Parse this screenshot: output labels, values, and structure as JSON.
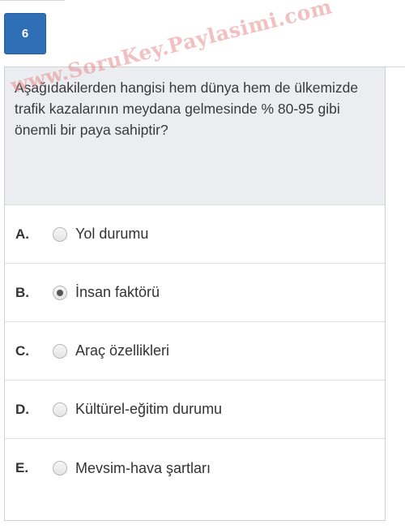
{
  "question_number": "6",
  "watermark": "www.SoruKey.Paylasimi.com",
  "question_text": "Aşağıdakilerden hangisi hem dünya hem de ülkemizde trafik kazalarının meydana gelmesinde % 80-95 gibi önemli bir paya sahiptir?",
  "options": [
    {
      "letter": "A.",
      "text": "Yol durumu",
      "selected": false
    },
    {
      "letter": "B.",
      "text": "İnsan faktörü",
      "selected": true
    },
    {
      "letter": "C.",
      "text": "Araç özellikleri",
      "selected": false
    },
    {
      "letter": "D.",
      "text": "Kültürel-eğitim durumu",
      "selected": false
    },
    {
      "letter": "E.",
      "text": "Mevsim-hava şartları",
      "selected": false
    }
  ],
  "colors": {
    "accent": "#2f6fb5",
    "question_bg": "#ebedf1",
    "watermark": "#e88c8c"
  }
}
